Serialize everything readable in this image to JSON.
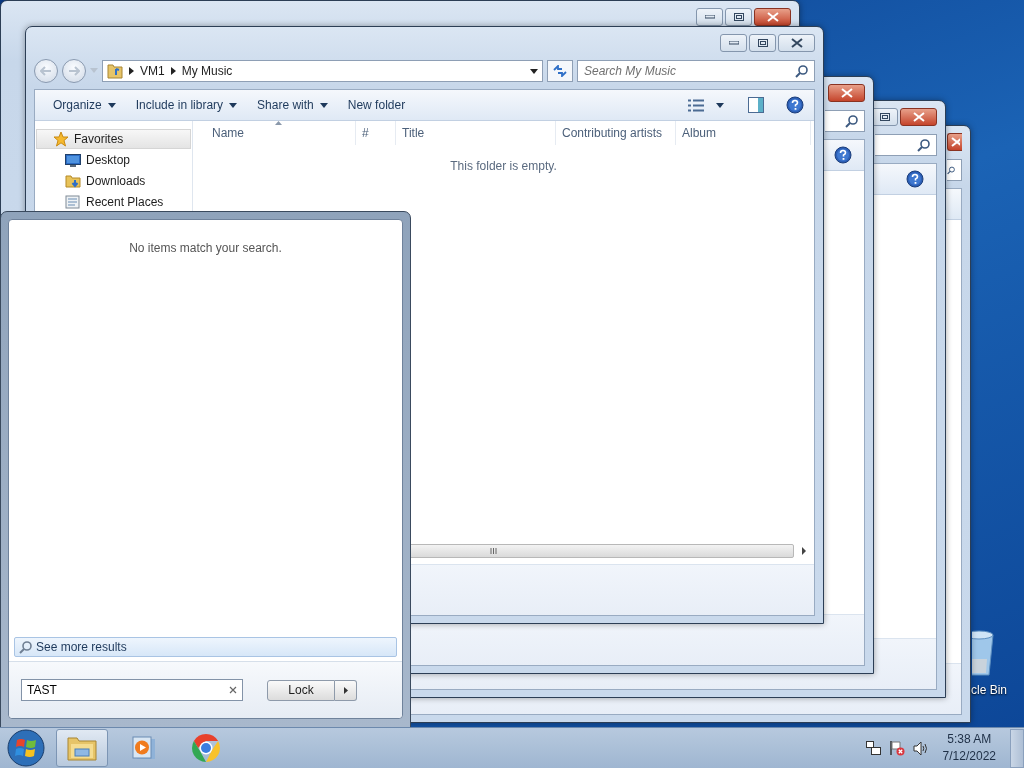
{
  "desktop": {
    "recycle_bin_label": "cle Bin"
  },
  "explorer": {
    "breadcrumb": [
      "VM1",
      "My Music"
    ],
    "search": {
      "placeholder": "Search My Music"
    },
    "toolbar": [
      {
        "label": "Organize",
        "dropdown": true
      },
      {
        "label": "Include in library",
        "dropdown": true
      },
      {
        "label": "Share with",
        "dropdown": true
      },
      {
        "label": "New folder",
        "dropdown": false
      }
    ],
    "nav_items": [
      {
        "label": "Favorites",
        "kind": "favorites",
        "selected": true
      },
      {
        "label": "Desktop",
        "kind": "desktop",
        "selected": false
      },
      {
        "label": "Downloads",
        "kind": "downloads",
        "selected": false
      },
      {
        "label": "Recent Places",
        "kind": "recent",
        "selected": false
      }
    ],
    "columns": [
      {
        "label": "Name",
        "sorted": true
      },
      {
        "label": "#",
        "sorted": false
      },
      {
        "label": "Title",
        "sorted": false
      },
      {
        "label": "Contributing artists",
        "sorted": false
      },
      {
        "label": "Album",
        "sorted": false
      }
    ],
    "empty_message": "This folder is empty."
  },
  "start_menu": {
    "message": "No items match your search.",
    "see_more": "See more results",
    "search": {
      "value": "TAST"
    },
    "power_button": "Lock"
  },
  "taskbar": {
    "apps": [
      {
        "kind": "explorer",
        "active": true
      },
      {
        "kind": "media",
        "active": false
      },
      {
        "kind": "browser",
        "active": false
      }
    ],
    "time": "5:38 AM",
    "date": "7/12/2022"
  }
}
